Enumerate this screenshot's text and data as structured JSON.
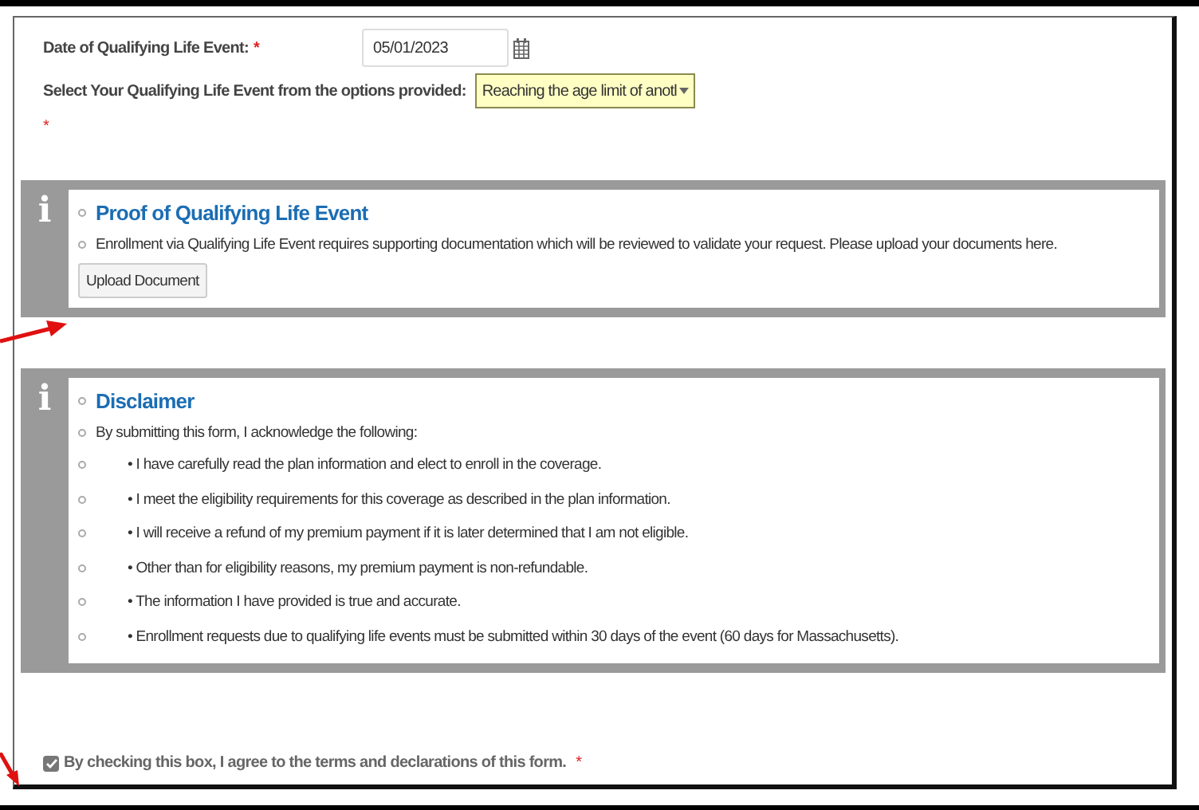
{
  "fields": [
    {
      "kind": "date",
      "label": "Date of Qualifying Life Event:",
      "required_mark": "*",
      "value": "05/01/2023"
    },
    {
      "kind": "select",
      "label": "Select Your Qualifying Life Event from the options provided:",
      "required_mark": "*",
      "value": "Reaching the age limit of anotl"
    }
  ],
  "panels": [
    {
      "icon": "i",
      "title": "Proof of Qualifying Life Event",
      "items": [
        {
          "kind": "text",
          "text": "Enrollment via Qualifying Life Event requires supporting documentation which will be reviewed to validate your request. Please upload your documents here."
        }
      ],
      "button": "Upload Document"
    },
    {
      "icon": "i",
      "title": "Disclaimer",
      "items": [
        {
          "kind": "text",
          "text": "By submitting this form, I acknowledge the following:"
        },
        {
          "kind": "sub",
          "text": "• I have carefully read the plan information and elect to enroll in the coverage."
        },
        {
          "kind": "sub",
          "text": "• I meet the eligibility requirements for this coverage as described in the plan information."
        },
        {
          "kind": "sub",
          "text": "• I will receive a refund of my premium payment if it is later determined that I am not eligible."
        },
        {
          "kind": "sub",
          "text": "• Other than for eligibility reasons, my premium payment is non-refundable."
        },
        {
          "kind": "sub",
          "text": "• The information I have provided is true and accurate."
        },
        {
          "kind": "sub",
          "text": "• Enrollment requests due to qualifying life events must be submitted within 30 days of the event (60 days for Massachusetts)."
        }
      ]
    }
  ],
  "agreement": {
    "label": "By checking this box, I agree to the terms and declarations of this form.",
    "required_mark": "*",
    "checked": true
  }
}
